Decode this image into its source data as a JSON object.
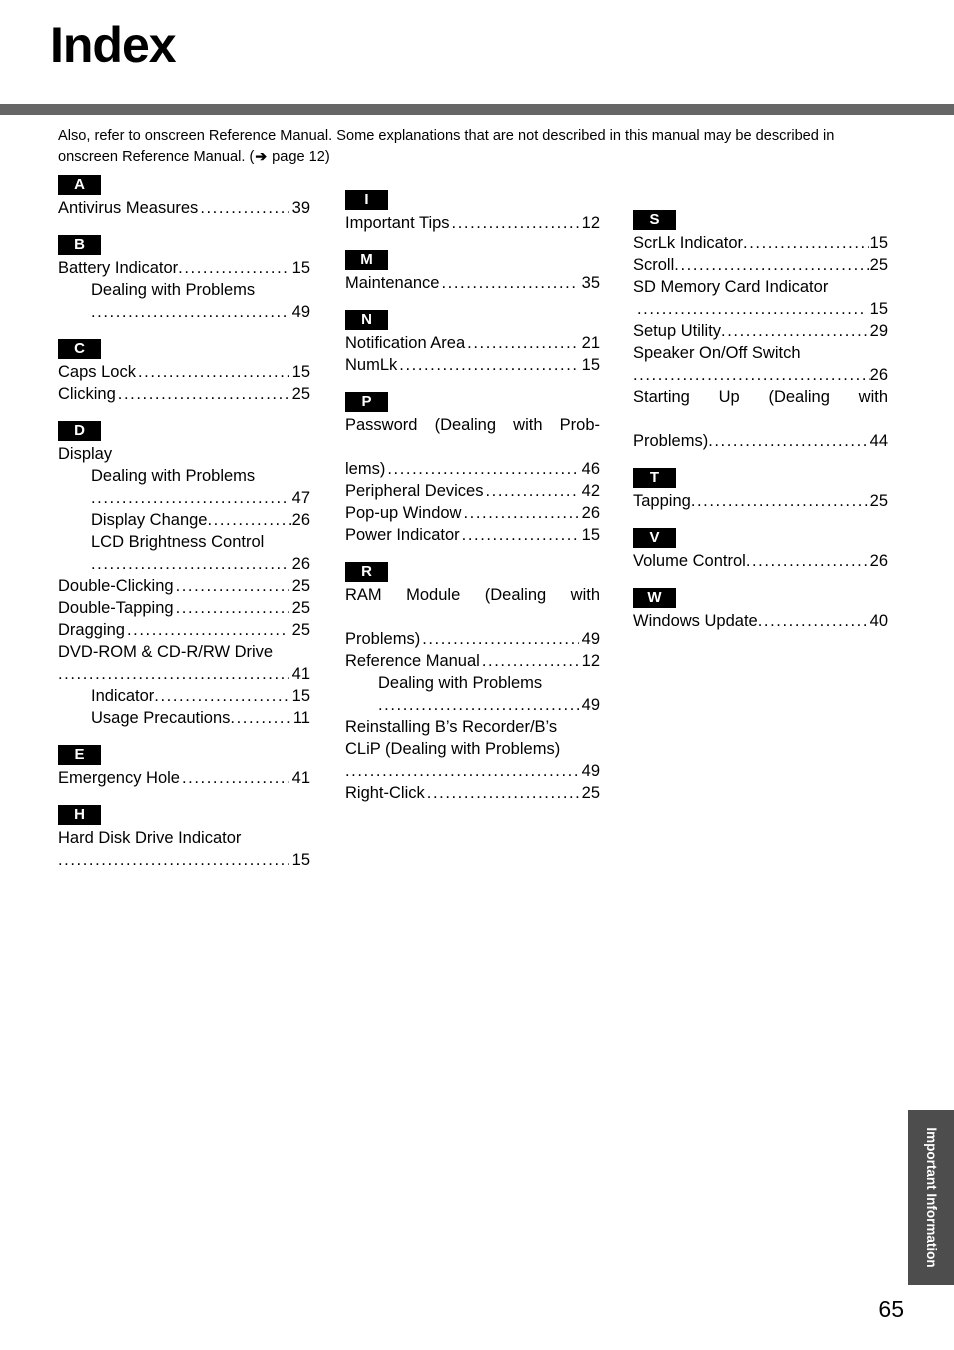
{
  "page": {
    "title": "Index",
    "number": "65",
    "side_tab_label": "Important Information",
    "accent_rule_color": "#666666",
    "side_tab_color": "#4d4d4d",
    "badge_color": "#000000"
  },
  "intro": {
    "line1": "Also, refer to onscreen Reference Manual. Some explanations that are not described in this manual may be described",
    "line2_before": "in onscreen Reference Manual. (",
    "arrow": "➔",
    "line2_after": " page 12)"
  },
  "dots": "..................................................",
  "columns": [
    {
      "id": "column-1",
      "groups": [
        {
          "letter": "A",
          "entries": [
            {
              "type": "leader",
              "label": "Antivirus Measures",
              "page": "39"
            }
          ]
        },
        {
          "letter": "B",
          "entries": [
            {
              "type": "leader",
              "label": "Battery Indicator",
              "page": "15",
              "tight": true
            },
            {
              "type": "subhead",
              "level": 1,
              "label": "Dealing with Problems"
            },
            {
              "type": "dotline",
              "indent": true,
              "page": "49"
            }
          ]
        },
        {
          "letter": "C",
          "entries": [
            {
              "type": "leader",
              "label": "Caps Lock",
              "page": "15"
            },
            {
              "type": "leader",
              "label": "Clicking",
              "page": "25"
            }
          ]
        },
        {
          "letter": "D",
          "entries": [
            {
              "type": "plain",
              "label": "Display"
            },
            {
              "type": "subhead",
              "level": 1,
              "label": "Dealing with Problems"
            },
            {
              "type": "dotline",
              "indent": true,
              "page": "47"
            },
            {
              "type": "leader",
              "label": "Display Change",
              "page": "26",
              "indent": 1,
              "nogap": true
            },
            {
              "type": "subhead",
              "level": 1,
              "label": "LCD Brightness Control"
            },
            {
              "type": "dotline",
              "indent": true,
              "page": "26"
            },
            {
              "type": "leader",
              "label": "Double-Clicking",
              "page": "25"
            },
            {
              "type": "leader",
              "label": "Double-Tapping",
              "page": "25"
            },
            {
              "type": "leader",
              "label": "Dragging",
              "page": "25"
            },
            {
              "type": "plain",
              "label": "DVD-ROM & CD-R/RW Drive"
            },
            {
              "type": "dotline",
              "page": "41"
            },
            {
              "type": "leader",
              "label": "Indicator",
              "page": "15",
              "indent": 1,
              "tight": true
            },
            {
              "type": "leader",
              "label": "Usage Precautions",
              "page": "11",
              "indent": 1,
              "nogap": true
            }
          ]
        },
        {
          "letter": "E",
          "entries": [
            {
              "type": "leader",
              "label": "Emergency Hole",
              "page": "41"
            }
          ]
        },
        {
          "letter": "H",
          "entries": [
            {
              "type": "plain",
              "label": "Hard Disk Drive Indicator"
            },
            {
              "type": "dotline",
              "page": "15"
            }
          ]
        }
      ]
    },
    {
      "id": "column-2",
      "groups": [
        {
          "letter": "I",
          "entries": [
            {
              "type": "leader",
              "label": "Important Tips",
              "page": "12"
            }
          ]
        },
        {
          "letter": "M",
          "entries": [
            {
              "type": "leader",
              "label": "Maintenance",
              "page": "35"
            }
          ]
        },
        {
          "letter": "N",
          "entries": [
            {
              "type": "leader",
              "label": "Notification Area",
              "page": "21"
            },
            {
              "type": "leader",
              "label": "NumLk",
              "page": "15"
            }
          ]
        },
        {
          "letter": "P",
          "entries": [
            {
              "type": "justified",
              "line": "Password (Dealing with Prob-"
            },
            {
              "type": "leader",
              "label": "lems)",
              "page": "46"
            },
            {
              "type": "leader",
              "label": "Peripheral Devices",
              "page": "42"
            },
            {
              "type": "leader",
              "label": "Pop-up Window",
              "page": "26"
            },
            {
              "type": "leader",
              "label": "Power Indicator",
              "page": "15"
            }
          ]
        },
        {
          "letter": "R",
          "entries": [
            {
              "type": "justified",
              "line": "RAM Module (Dealing with"
            },
            {
              "type": "leader",
              "label": "Problems)",
              "page": "49"
            },
            {
              "type": "leader",
              "label": "Reference Manual",
              "page": "12"
            },
            {
              "type": "subhead",
              "level": 1,
              "label": "Dealing with Problems"
            },
            {
              "type": "dotline",
              "indent": true,
              "page": "49"
            },
            {
              "type": "plain",
              "label": "Reinstalling B’s Recorder/B’s"
            },
            {
              "type": "plain",
              "label": "CLiP (Dealing with Problems)"
            },
            {
              "type": "dotline",
              "page": "49"
            },
            {
              "type": "leader",
              "label": "Right-Click",
              "page": "25"
            }
          ]
        }
      ]
    },
    {
      "id": "column-3",
      "groups": [
        {
          "letter": "S",
          "entries": [
            {
              "type": "leader",
              "label": "ScrLk Indicator",
              "page": "15",
              "nogap": true
            },
            {
              "type": "leader",
              "label": "Scroll",
              "page": "25",
              "nogap": true
            },
            {
              "type": "plain",
              "label": "SD Memory Card Indicator"
            },
            {
              "type": "dotline",
              "page": "15",
              "pad": true
            },
            {
              "type": "leader",
              "label": "Setup Utility",
              "page": "29",
              "tight": true
            },
            {
              "type": "plain",
              "label": "Speaker On/Off Switch"
            },
            {
              "type": "dotline",
              "page": "26",
              "nogap": true
            },
            {
              "type": "justified",
              "line": "Starting Up (Dealing with"
            },
            {
              "type": "leader",
              "label": "Problems)",
              "page": "44",
              "nogap": true
            }
          ]
        },
        {
          "letter": "T",
          "entries": [
            {
              "type": "leader",
              "label": "Tapping",
              "page": "25",
              "nogap": true
            }
          ]
        },
        {
          "letter": "V",
          "entries": [
            {
              "type": "leader",
              "label": "Volume Control",
              "page": "26",
              "nogap": true
            }
          ]
        },
        {
          "letter": "W",
          "entries": [
            {
              "type": "leader",
              "label": "Windows Update",
              "page": "40",
              "nogap": true
            }
          ]
        }
      ]
    }
  ]
}
